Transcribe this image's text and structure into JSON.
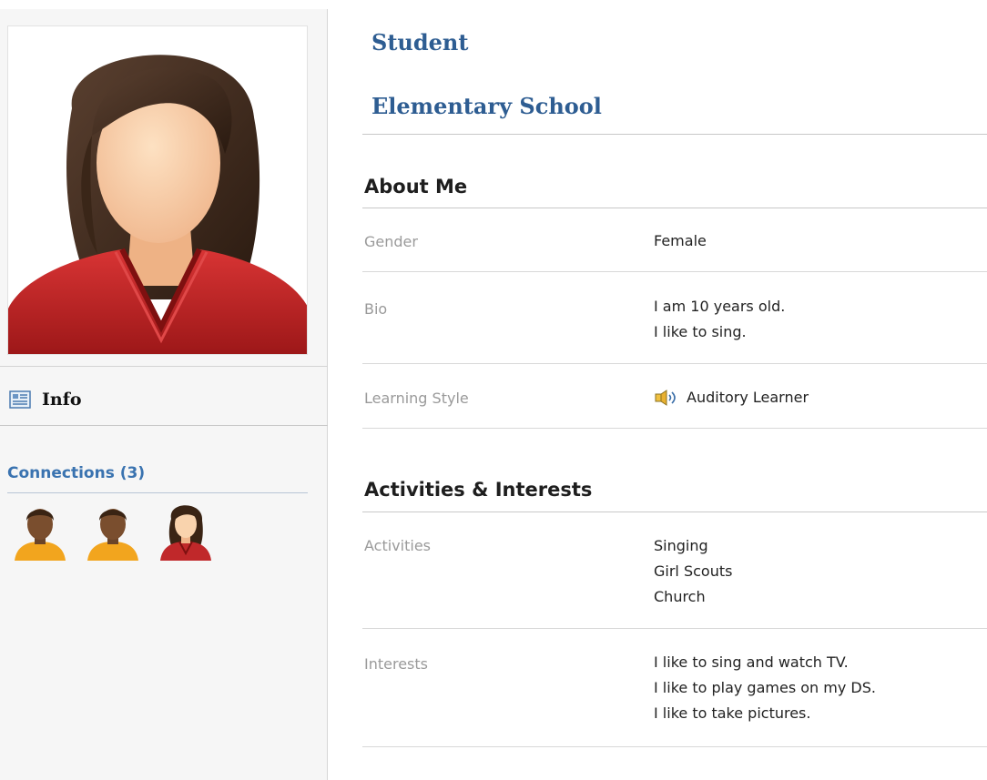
{
  "profile": {
    "role": "Student",
    "school": "Elementary School"
  },
  "sidebar": {
    "photo_icon": "female-avatar",
    "info": {
      "icon": "info-card-icon",
      "label": "Info"
    },
    "connections": {
      "title": "Connections (3)",
      "avatars": [
        "boy-avatar",
        "boy-avatar",
        "girl-avatar"
      ]
    }
  },
  "about_me": {
    "title": "About Me",
    "gender": {
      "label": "Gender",
      "value": "Female"
    },
    "bio": {
      "label": "Bio",
      "lines": [
        "I am 10 years old.",
        "I like to sing."
      ]
    },
    "learning_style": {
      "label": "Learning Style",
      "icon": "speaker-icon",
      "value": "Auditory Learner"
    }
  },
  "activities_interests": {
    "title": "Activities & Interests",
    "activities": {
      "label": "Activities",
      "lines": [
        "Singing",
        "Girl Scouts",
        "Church"
      ]
    },
    "interests": {
      "label": "Interests",
      "lines": [
        "I like to sing and watch TV.",
        "I like to play games on my DS.",
        "I like to take pictures."
      ]
    }
  },
  "colors": {
    "heading_blue": "#2e5d92",
    "link_blue": "#3a73b0",
    "shirt_red": "#c0282a",
    "skin": "#f7c99c"
  }
}
